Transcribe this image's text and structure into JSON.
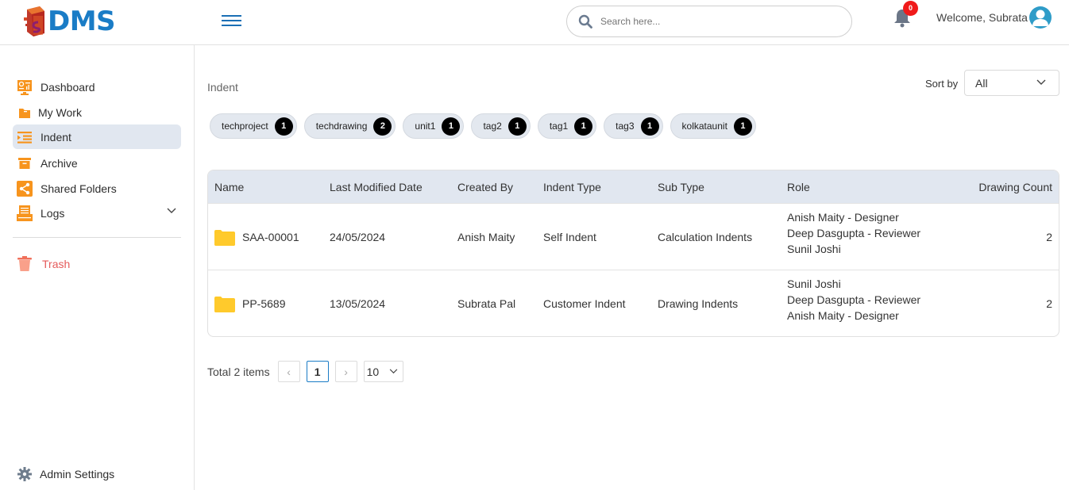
{
  "header": {
    "logo_text": "DMS",
    "search_placeholder": "Search here...",
    "notification_count": "0",
    "welcome_text": "Welcome, Subrata"
  },
  "sidebar": {
    "items": [
      {
        "label": "Dashboard",
        "icon": "dashboard-icon"
      },
      {
        "label": "My Work",
        "icon": "folder-icon"
      },
      {
        "label": "Indent",
        "icon": "list-indent-icon",
        "active": true
      },
      {
        "label": "Archive",
        "icon": "archive-icon"
      },
      {
        "label": "Shared Folders",
        "icon": "share-icon"
      },
      {
        "label": "Logs",
        "icon": "logs-icon",
        "expandable": true
      }
    ],
    "trash_label": "Trash",
    "admin_settings_label": "Admin Settings"
  },
  "main": {
    "breadcrumb": "Indent",
    "sort_label": "Sort by",
    "sort_value": "All",
    "tags": [
      {
        "label": "techproject",
        "count": "1"
      },
      {
        "label": "techdrawing",
        "count": "2"
      },
      {
        "label": "unit1",
        "count": "1"
      },
      {
        "label": "tag2",
        "count": "1"
      },
      {
        "label": "tag1",
        "count": "1"
      },
      {
        "label": "tag3",
        "count": "1"
      },
      {
        "label": "kolkataunit",
        "count": "1"
      }
    ],
    "table": {
      "columns": [
        "Name",
        "Last Modified Date",
        "Created By",
        "Indent Type",
        "Sub Type",
        "Role",
        "Drawing Count"
      ],
      "rows": [
        {
          "name": "SAA-00001",
          "date": "24/05/2024",
          "created_by": "Anish Maity",
          "indent_type": "Self Indent",
          "sub_type": "Calculation Indents",
          "roles": [
            "Anish Maity - Designer",
            "Deep Dasgupta - Reviewer",
            "Sunil Joshi"
          ],
          "drawing_count": "2"
        },
        {
          "name": "PP-5689",
          "date": "13/05/2024",
          "created_by": "Subrata Pal",
          "indent_type": "Customer Indent",
          "sub_type": "Drawing Indents",
          "roles": [
            "Sunil Joshi",
            "Deep Dasgupta - Reviewer",
            "Anish Maity - Designer"
          ],
          "drawing_count": "2"
        }
      ]
    },
    "pagination": {
      "total_text": "Total 2 items",
      "prev": "‹",
      "current_page": "1",
      "next": "›",
      "page_size": "10"
    }
  },
  "colors": {
    "brand": "#1a7cc6",
    "accent_orange": "#f7941d",
    "active_bg": "#e1e7f0",
    "danger": "#e55a5a",
    "folder": "#ffc928"
  }
}
